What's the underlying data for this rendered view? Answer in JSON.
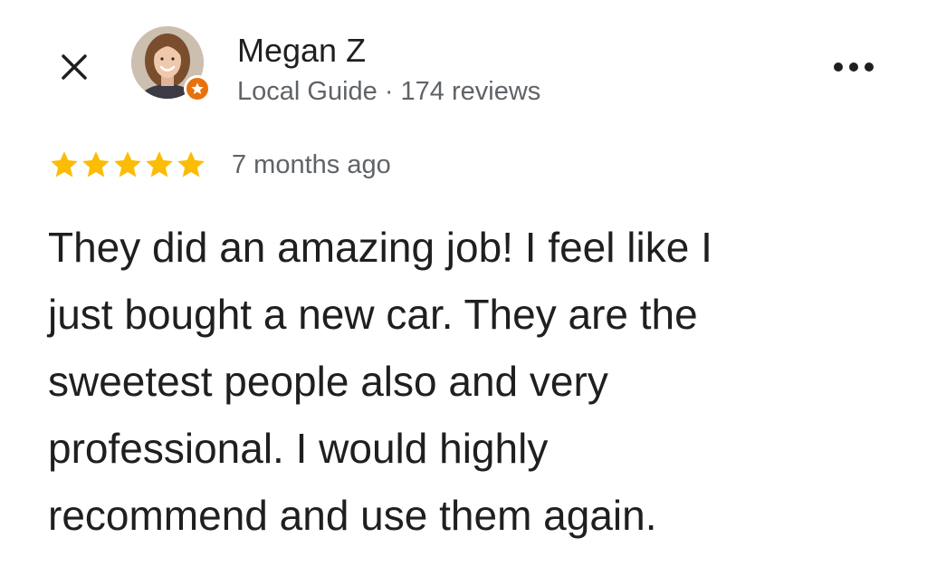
{
  "reviewer": {
    "name": "Megan Z",
    "meta": "Local Guide · 174 reviews",
    "avatar_icon": "person-photo",
    "badge_icon": "local-guide-star-icon"
  },
  "review": {
    "rating": 5,
    "rating_max": 5,
    "time": "7 months ago",
    "lines": [
      "They did an amazing job! I feel like I",
      "just bought a new car. They are the",
      "sweetest people also and very",
      "professional. I would highly",
      "recommend and use them again."
    ]
  },
  "colors": {
    "star": "#fbbc04",
    "badge": "#e8710a",
    "text_primary": "#1f1f1f",
    "text_secondary": "#5f6368"
  },
  "icons": {
    "close": "close-icon",
    "more": "more-options-icon"
  }
}
